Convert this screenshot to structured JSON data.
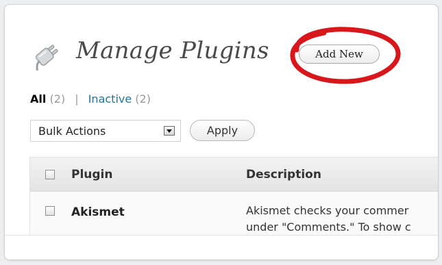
{
  "header": {
    "title": "Manage Plugins",
    "add_new_label": "Add New",
    "icon": "plugin-plug-icon",
    "highlight_color": "#d8171d"
  },
  "filters": {
    "all_label": "All",
    "all_count": "(2)",
    "separator": "|",
    "inactive_label": "Inactive",
    "inactive_count": "(2)"
  },
  "bulk": {
    "selected": "Bulk Actions",
    "apply_label": "Apply"
  },
  "table": {
    "columns": [
      "Plugin",
      "Description"
    ],
    "rows": [
      {
        "name": "Akismet",
        "description_lines": [
          "Akismet checks your commer",
          "under \"Comments.\" To show c"
        ]
      }
    ]
  },
  "colors": {
    "link": "#21759b",
    "title": "#4a4a4a"
  }
}
